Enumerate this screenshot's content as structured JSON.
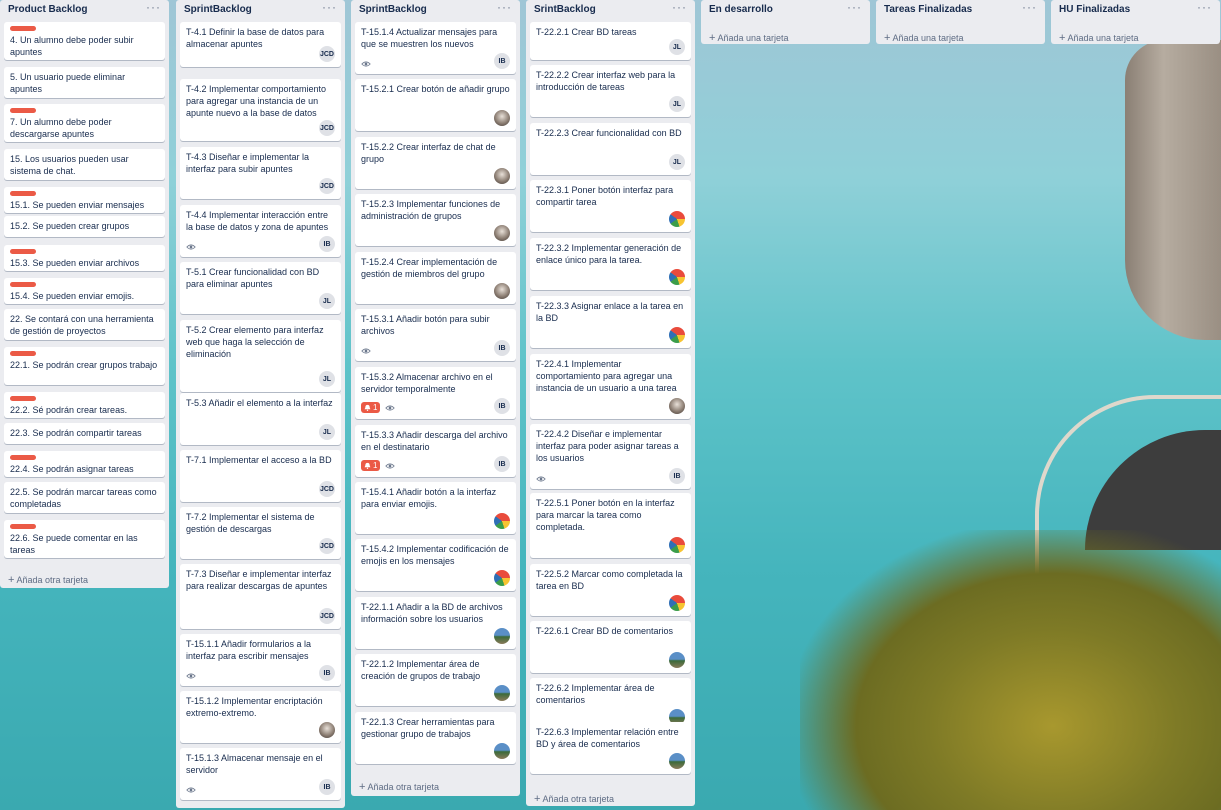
{
  "board": {
    "lists": [
      {
        "title": "Product Backlog",
        "add_label": "Añada otra tarjeta",
        "cards": [
          {
            "title": "4. Un alumno debe poder subir apuntes",
            "label": true
          },
          {
            "title": "5. Un usuario puede eliminar apuntes",
            "label": false
          },
          {
            "title": "7. Un alumno debe poder descargarse apuntes",
            "label": true
          },
          {
            "title": "15. Los usuarios pueden usar sistema de chat.",
            "label": false
          },
          {
            "title": "15.1. Se pueden enviar mensajes",
            "label": true
          },
          {
            "title": "15.2. Se pueden crear grupos",
            "label": false
          },
          {
            "title": "15.3. Se pueden enviar archivos",
            "label": true
          },
          {
            "title": "15.4. Se pueden enviar emojis.",
            "label": true
          },
          {
            "title": "22. Se contará con una herramienta de gestión de proyectos",
            "label": false
          },
          {
            "title": "22.1. Se podrán crear grupos trabajo",
            "label": true
          },
          {
            "title": "22.2. Sé podrán crear tareas.",
            "label": true
          },
          {
            "title": "22.3. Se podrán compartir tareas",
            "label": false
          },
          {
            "title": "22.4. Se podrán asignar tareas",
            "label": true
          },
          {
            "title": "22.5. Se podrán marcar tareas como completadas",
            "label": false
          },
          {
            "title": "22.6. Se puede comentar en las tareas",
            "label": true
          }
        ]
      },
      {
        "title": "SprintBacklog",
        "add_label": "",
        "cards": [
          {
            "title": "T-4.1 Definir la base de datos para almacenar apuntes",
            "member": "JCD"
          },
          {
            "title": "T-4.2 Implementar comportamiento para agregar una instancia de un apunte nuevo a la base de datos",
            "member": "JCD"
          },
          {
            "title": "T-4.3 Diseñar e implementar la interfaz para subir apuntes",
            "member": "JCD"
          },
          {
            "title": "T-4.4 Implementar interacción entre la base de datos y zona de apuntes",
            "member": "IB",
            "watch": true
          },
          {
            "title": "T-5.1 Crear funcionalidad con BD para eliminar apuntes",
            "member": "JL"
          },
          {
            "title": "T-5.2 Crear elemento para interfaz web que haga la selección de eliminación",
            "member": "JL"
          },
          {
            "title": "T-5.3 Añadir el elemento a la interfaz",
            "member": "JL"
          },
          {
            "title": "T-7.1 Implementar el acceso a la BD",
            "member": "JCD"
          },
          {
            "title": "T-7.2 Implementar el sistema de gestión de descargas",
            "member": "JCD"
          },
          {
            "title": "T-7.3 Diseñar e implementar interfaz para realizar descargas de apuntes",
            "member": "JCD"
          },
          {
            "title": "T-15.1.1 Añadir formularios a la interfaz para escribir mensajes",
            "member": "IB",
            "watch": true
          },
          {
            "title": "T-15.1.2 Implementar encriptación extremo-extremo.",
            "avatar": "sphynx"
          },
          {
            "title": "T-15.1.3 Almacenar mensaje en el servidor",
            "member": "IB",
            "watch": true
          }
        ]
      },
      {
        "title": "SprintBacklog",
        "add_label": "Añada otra tarjeta",
        "cards": [
          {
            "title": "T-15.1.4 Actualizar mensajes para que se muestren los nuevos",
            "member": "IB",
            "watch": true
          },
          {
            "title": "T-15.2.1 Crear botón de añadir grupo",
            "avatar": "sphynx"
          },
          {
            "title": "T-15.2.2 Crear interfaz de chat de grupo",
            "avatar": "sphynx"
          },
          {
            "title": "T-15.2.3 Implementar funciones de administración de grupos",
            "avatar": "sphynx"
          },
          {
            "title": "T-15.2.4 Crear implementación de gestión de miembros del grupo",
            "avatar": "sphynx"
          },
          {
            "title": "T-15.3.1 Añadir botón para subir archivos",
            "member": "IB",
            "watch": true
          },
          {
            "title": "T-15.3.2 Almacenar archivo en el servidor temporalmente",
            "member": "IB",
            "watch": true,
            "alert": "1"
          },
          {
            "title": "T-15.3.3 Añadir descarga del archivo en el destinatario",
            "member": "IB",
            "watch": true,
            "alert": "1"
          },
          {
            "title": "T-15.4.1 Añadir botón a la interfaz para enviar emojis.",
            "avatar": "parrot"
          },
          {
            "title": "T-15.4.2 Implementar codificación de emojis en los mensajes",
            "avatar": "parrot"
          },
          {
            "title": "T-22.1.1 Añadir a la BD de archivos información sobre los usuarios",
            "avatar": "landscape"
          },
          {
            "title": "T-22.1.2 Implementar área de creación de grupos de trabajo",
            "avatar": "landscape"
          },
          {
            "title": "T-22.1.3 Crear herramientas para gestionar grupo de trabajos",
            "avatar": "landscape"
          }
        ]
      },
      {
        "title": "SrintBacklog",
        "add_label": "Añada otra tarjeta",
        "cards": [
          {
            "title": "T-22.2.1 Crear BD tareas",
            "member": "JL"
          },
          {
            "title": "T-22.2.2 Crear interfaz web para la introducción de tareas",
            "member": "JL"
          },
          {
            "title": "T-22.2.3 Crear funcionalidad con BD",
            "member": "JL"
          },
          {
            "title": "T-22.3.1 Poner botón interfaz para compartir tarea",
            "avatar": "parrot"
          },
          {
            "title": "T-22.3.2 Implementar generación de enlace único para la tarea.",
            "avatar": "parrot"
          },
          {
            "title": "T-22.3.3 Asignar enlace a la tarea en la BD",
            "avatar": "parrot"
          },
          {
            "title": "T-22.4.1 Implementar comportamiento para agregar una instancia de un usuario a una tarea",
            "avatar": "sphynx"
          },
          {
            "title": "T-22.4.2 Diseñar e implementar interfaz para poder asignar tareas a los usuarios",
            "member": "IB",
            "watch": true
          },
          {
            "title": "T-22.5.1 Poner botón en la interfaz para marcar la tarea como completada.",
            "avatar": "parrot"
          },
          {
            "title": "T-22.5.2 Marcar como completada la tarea en BD",
            "avatar": "parrot"
          },
          {
            "title": "T-22.6.1 Crear BD de comentarios",
            "avatar": "landscape"
          },
          {
            "title": "T-22.6.2 Implementar área de comentarios",
            "avatar": "landscape"
          },
          {
            "title": "T-22.6.3 Implementar relación entre BD y área de comentarios",
            "avatar": "landscape"
          }
        ]
      },
      {
        "title": "En desarrollo",
        "add_label": "Añada una tarjeta",
        "cards": []
      },
      {
        "title": "Tareas Finalizadas",
        "add_label": "Añada una tarjeta",
        "cards": []
      },
      {
        "title": "HU Finalizadas",
        "add_label": "Añada una tarjeta",
        "cards": []
      }
    ]
  },
  "colors": {
    "label_red": "#eb5a46",
    "list_bg": "#ebecf0"
  }
}
